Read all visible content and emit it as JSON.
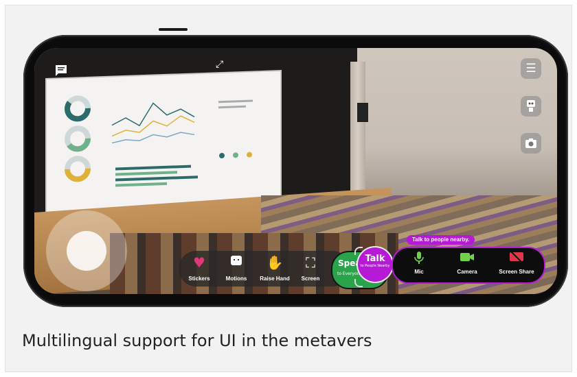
{
  "caption": "Multilingual support for UI in the metavers",
  "icons": {
    "chat": "chat-icon",
    "expand": "expand-icon",
    "menu": "menu-icon",
    "avatar": "avatar-icon",
    "camera": "camera-snapshot-icon"
  },
  "toolbar": {
    "stickers": "Stickers",
    "motions": "Motions",
    "raise_hand": "Raise Hand",
    "screen": "Screen"
  },
  "speak": {
    "label": "Speak",
    "sub": "to Everyone"
  },
  "talk": {
    "label": "Talk",
    "sub": "to People Nearby"
  },
  "media": {
    "mic": "Mic",
    "camera": "Camera",
    "screen_share": "Screen Share"
  },
  "banner": "Talk to people nearby.",
  "colors": {
    "accent": "#b61ad6",
    "speak": "#2aa34a",
    "stickers": "#e0367a",
    "raise_hand": "#6fd24a",
    "screen_share": "#e0364a"
  },
  "slide": {
    "donuts": [
      "60%",
      "40%",
      "50%"
    ]
  }
}
